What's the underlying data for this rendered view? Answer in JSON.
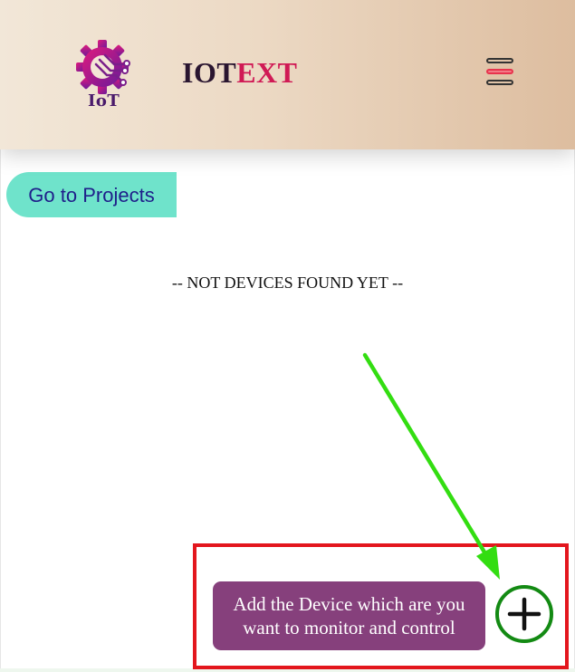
{
  "header": {
    "logo_text": "IoT",
    "brand_part1": "IOT",
    "brand_part2": "EXT",
    "menu_icon": "hamburger-menu-icon"
  },
  "nav": {
    "projects_button": "Go to Projects"
  },
  "devices": {
    "empty_message": "-- NOT DEVICES FOUND YET --"
  },
  "add_device": {
    "tooltip": "Add the Device which are you want to monitor and control",
    "icon": "plus-circle-icon"
  },
  "colors": {
    "header_gradient_start": "#f2e7d8",
    "header_gradient_end": "#ddbd9f",
    "brand_accent": "#d01a55",
    "projects_button_bg": "#6fe3cb",
    "tooltip_bg": "#86407c",
    "add_button_ring": "#138a13",
    "highlight_box": "#e3161d",
    "annotation_arrow": "#33dd11"
  }
}
